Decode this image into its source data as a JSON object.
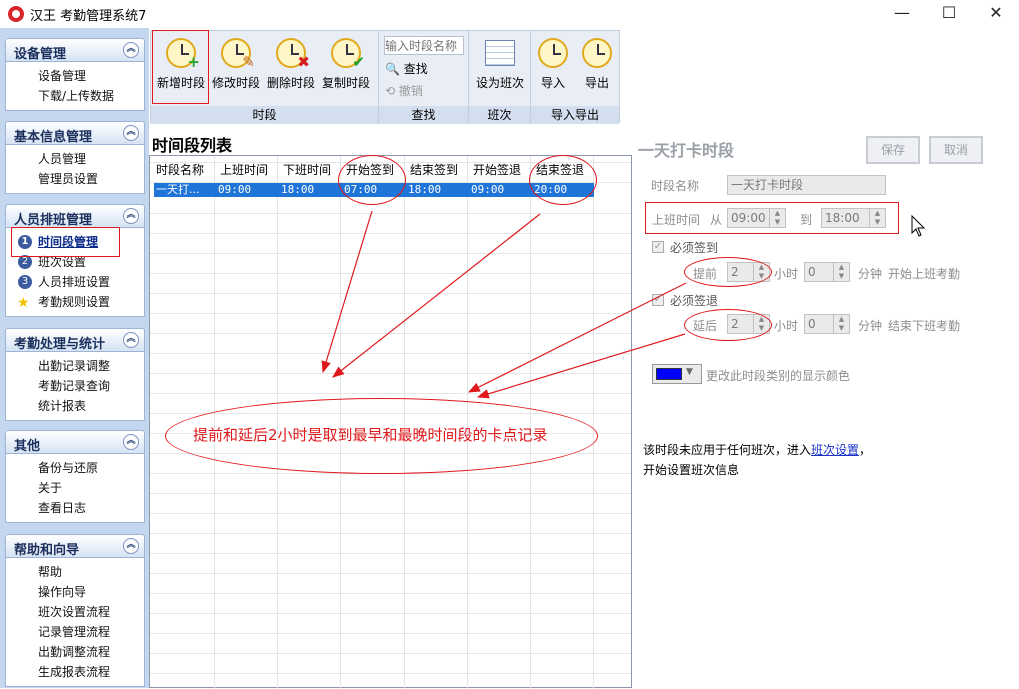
{
  "window": {
    "title": "汉王 考勤管理系统7",
    "minimize": "—",
    "maximize": "☐",
    "close": "✕"
  },
  "nav": {
    "groups": [
      {
        "title": "设备管理",
        "items": [
          "设备管理",
          "下载/上传数据"
        ]
      },
      {
        "title": "基本信息管理",
        "items": [
          "人员管理",
          "管理员设置"
        ]
      },
      {
        "title": "人员排班管理",
        "items": [
          "时间段管理",
          "班次设置",
          "人员排班设置",
          "考勤规则设置"
        ],
        "numbers": [
          "1",
          "2",
          "3"
        ]
      },
      {
        "title": "考勤处理与统计",
        "items": [
          "出勤记录调整",
          "考勤记录查询",
          "统计报表"
        ]
      },
      {
        "title": "其他",
        "items": [
          "备份与还原",
          "关于",
          "查看日志"
        ]
      },
      {
        "title": "帮助和向导",
        "items": [
          "帮助",
          "操作向导",
          "班次设置流程",
          "记录管理流程",
          "出勤调整流程",
          "生成报表流程"
        ]
      }
    ]
  },
  "ribbon": {
    "time_group": {
      "label": "时段",
      "buttons": [
        "新增时段",
        "修改时段",
        "删除时段",
        "复制时段"
      ],
      "badges": [
        "+",
        "✎",
        "✖",
        "✔"
      ]
    },
    "search_group": {
      "label": "查找",
      "placeholder": "输入时段名称",
      "find": "查找",
      "undo": "撤销"
    },
    "shift_group": {
      "label": "班次",
      "button": "设为班次"
    },
    "io_group": {
      "label": "导入导出",
      "import": "导入",
      "export": "导出"
    }
  },
  "list": {
    "title": "时间段列表",
    "columns": [
      "时段名称",
      "上班时间",
      "下班时间",
      "开始签到",
      "结束签到",
      "开始签退",
      "结束签退"
    ],
    "rows": [
      [
        "一天打...",
        "09:00",
        "18:00",
        "07:00",
        "18:00",
        "09:00",
        "20:00"
      ]
    ]
  },
  "detail": {
    "title": "一天打卡时段",
    "save": "保存",
    "cancel": "取消",
    "name_label": "时段名称",
    "name_value": "一天打卡时段",
    "work_time_label": "上班时间",
    "from": "从",
    "from_value": "09:00",
    "to": "到",
    "to_value": "18:00",
    "must_checkin": "必须签到",
    "advance_label": "提前",
    "advance_hours": "2",
    "hour_unit": "小时",
    "advance_minutes": "0",
    "minute_unit": "分钟",
    "checkin_note": "开始上班考勤",
    "must_checkout": "必须签退",
    "delay_label": "延后",
    "delay_hours": "2",
    "delay_minutes": "0",
    "checkout_note": "结束下班考勤",
    "color_label": "更改此时段类别的显示颜色",
    "color": "#0000ff",
    "info_prefix": "该时段未应用于任何班次，进入",
    "info_link": "班次设置",
    "info_suffix": "，",
    "info_line2": "开始设置班次信息"
  },
  "annotation": {
    "text": "提前和延后2小时是取到最早和最晚时间段的卡点记录",
    "color": "#e0191c"
  }
}
